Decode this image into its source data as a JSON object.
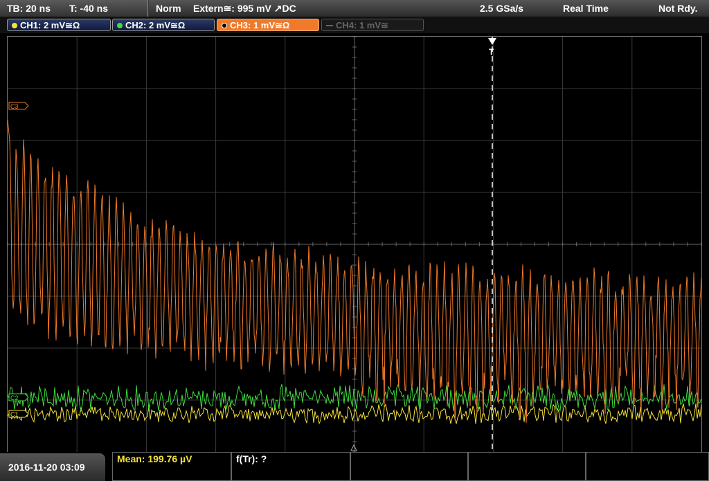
{
  "top_left": {
    "timebase": "TB: 20 ns",
    "trigger_time": "T: -40 ns"
  },
  "status": {
    "mode": "Norm",
    "trigger_source": "Extern≅: 995 mV ↗DC",
    "sample_rate": "2.5 GSa/s",
    "acq_mode": "Real Time",
    "state": "Not Rdy."
  },
  "channels": [
    {
      "label": "CH1: 2 mV≅Ω",
      "color": "#f4e23a",
      "state": "on"
    },
    {
      "label": "CH2: 2 mV≅Ω",
      "color": "#3fdc3f",
      "state": "on"
    },
    {
      "label": "CH3: 1 mV≅Ω",
      "color": "#f07a2a",
      "state": "active"
    },
    {
      "label": "CH4: 1 mV≅",
      "color": "#666666",
      "state": "off"
    }
  ],
  "markers": {
    "ch3": "C3",
    "ch2": "C2",
    "ch1": "C1",
    "trigger": "T"
  },
  "measurements": {
    "mean": "Mean: 199.76 µV",
    "freq": "f(Tr): ?"
  },
  "datetime": "2016-11-20 03:09",
  "colors": {
    "ch1": "#f4e23a",
    "ch2": "#3fdc3f",
    "ch3": "#f07a2a",
    "grid": "#3a3a3a"
  },
  "chart_data": {
    "type": "line",
    "grid": true,
    "divisions": {
      "horizontal": 10,
      "vertical": 8
    },
    "series": [
      {
        "name": "CH3",
        "description_values": "decaying-then-steady oscillation"
      },
      {
        "name": "CH2"
      },
      {
        "name": "CH1"
      }
    ]
  }
}
